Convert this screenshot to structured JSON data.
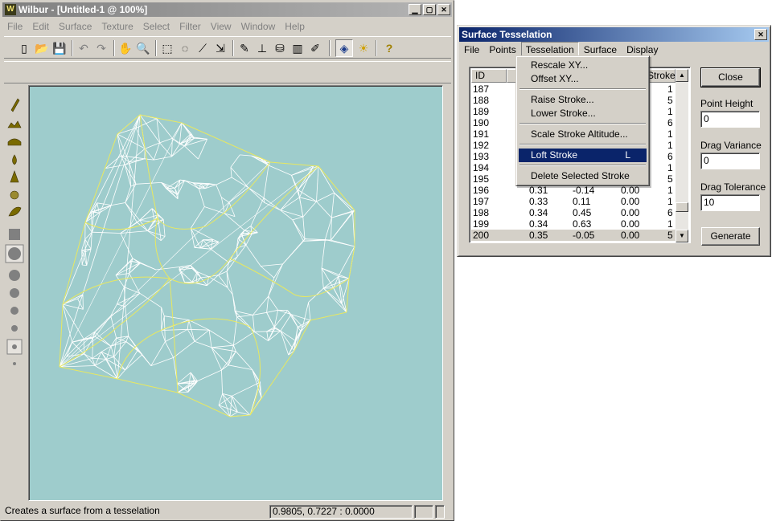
{
  "app": {
    "title": "Wilbur - [Untitled-1 @ 100%]",
    "logo_letter": "W",
    "window_buttons": [
      "minimize",
      "maximize",
      "close"
    ]
  },
  "menubar": [
    "File",
    "Edit",
    "Surface",
    "Texture",
    "Select",
    "Filter",
    "View",
    "Window",
    "Help"
  ],
  "toolbar": [
    {
      "name": "new-icon",
      "glyph": "▯"
    },
    {
      "name": "open-icon",
      "glyph": "📂"
    },
    {
      "name": "save-icon",
      "glyph": "💾"
    },
    {
      "name": "undo-icon",
      "glyph": "↶"
    },
    {
      "name": "redo-icon",
      "glyph": "↷"
    },
    {
      "name": "hand-icon",
      "glyph": "✋"
    },
    {
      "name": "zoom-icon",
      "glyph": "🔍"
    },
    {
      "name": "rect-select-icon",
      "glyph": "⬚"
    },
    {
      "name": "lasso-icon",
      "glyph": "◌"
    },
    {
      "name": "magic-wand-icon",
      "glyph": "⟋"
    },
    {
      "name": "move-select-icon",
      "glyph": "⇲"
    },
    {
      "name": "brush-icon",
      "glyph": "✎"
    },
    {
      "name": "stamp-icon",
      "glyph": "⊥"
    },
    {
      "name": "bucket-icon",
      "glyph": "⛁"
    },
    {
      "name": "gradient-icon",
      "glyph": "▥"
    },
    {
      "name": "pencil-icon",
      "glyph": "✐"
    },
    {
      "name": "view-3d-icon",
      "glyph": "◈"
    },
    {
      "name": "light-icon",
      "glyph": "☀"
    },
    {
      "name": "help-icon",
      "glyph": "?"
    }
  ],
  "status": {
    "message": "Creates a surface from a tesselation",
    "coords": "0.9805, 0.7227 : 0.0000"
  },
  "dialog": {
    "title": "Surface Tesselation",
    "menu": [
      "File",
      "Points",
      "Tesselation",
      "Surface",
      "Display"
    ],
    "columns": [
      "ID",
      "Stroke"
    ],
    "rows": [
      {
        "id": "187",
        "x": "",
        "y": "",
        "z": "",
        "stroke": "1"
      },
      {
        "id": "188",
        "x": "",
        "y": "",
        "z": "",
        "stroke": "5"
      },
      {
        "id": "189",
        "x": "",
        "y": "",
        "z": "",
        "stroke": "1"
      },
      {
        "id": "190",
        "x": "",
        "y": "",
        "z": "",
        "stroke": "6"
      },
      {
        "id": "191",
        "x": "",
        "y": "",
        "z": "",
        "stroke": "1"
      },
      {
        "id": "192",
        "x": "",
        "y": "",
        "z": "",
        "stroke": "1"
      },
      {
        "id": "193",
        "x": "",
        "y": "",
        "z": "",
        "stroke": "6"
      },
      {
        "id": "194",
        "x": "",
        "y": "",
        "z": "",
        "stroke": "1"
      },
      {
        "id": "195",
        "x": "",
        "y": "",
        "z": "",
        "stroke": "5"
      },
      {
        "id": "196",
        "x": "0.31",
        "y": "-0.14",
        "z": "0.00",
        "stroke": "1"
      },
      {
        "id": "197",
        "x": "0.33",
        "y": "0.11",
        "z": "0.00",
        "stroke": "1"
      },
      {
        "id": "198",
        "x": "0.34",
        "y": "0.45",
        "z": "0.00",
        "stroke": "6"
      },
      {
        "id": "199",
        "x": "0.34",
        "y": "0.63",
        "z": "0.00",
        "stroke": "1"
      },
      {
        "id": "200",
        "x": "0.35",
        "y": "-0.05",
        "z": "0.00",
        "stroke": "5"
      }
    ],
    "close_label": "Close",
    "point_height_label": "Point Height",
    "point_height_value": "0",
    "drag_variance_label": "Drag Variance",
    "drag_variance_value": "0",
    "drag_tolerance_label": "Drag Tolerance",
    "drag_tolerance_value": "10",
    "generate_label": "Generate"
  },
  "tesselation_menu": {
    "items": [
      {
        "label": "Rescale XY...",
        "shortcut": ""
      },
      {
        "label": "Offset XY...",
        "shortcut": ""
      },
      {
        "label": "Raise Stroke...",
        "shortcut": ""
      },
      {
        "label": "Lower Stroke...",
        "shortcut": ""
      },
      {
        "label": "Scale Stroke Altitude...",
        "shortcut": ""
      },
      {
        "label": "Loft Stroke",
        "shortcut": "L"
      },
      {
        "label": "Delete Selected Stroke",
        "shortcut": ""
      }
    ]
  },
  "colors": {
    "canvas_bg": "#9ecccc",
    "mesh_white": "#ffffff",
    "mesh_yellow": "#e8e860",
    "dialog_title": "#0a246a",
    "menu_highlight": "#0a246a"
  }
}
